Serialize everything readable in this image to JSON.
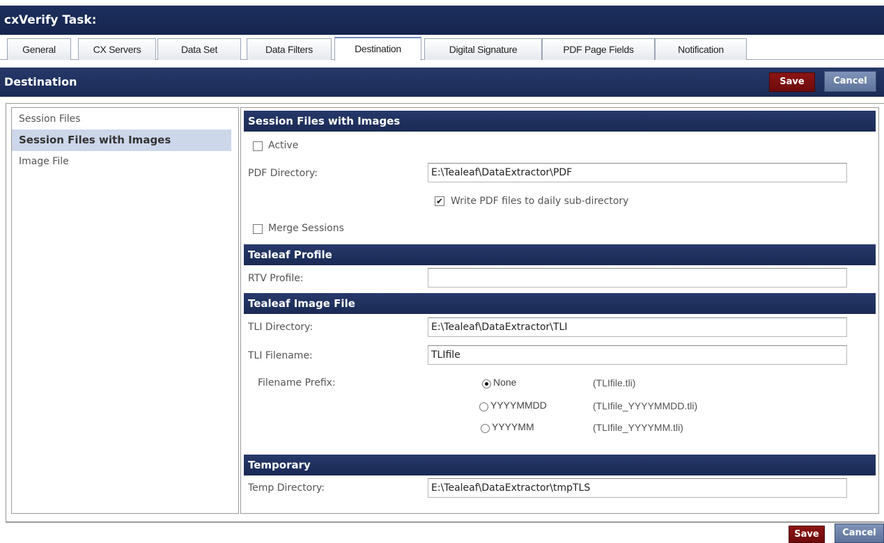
{
  "window": {
    "title": "cxVerify Task:"
  },
  "tabs": [
    {
      "label": "General",
      "active": false
    },
    {
      "label": "CX Servers",
      "active": false
    },
    {
      "label": "Data Set",
      "active": false
    },
    {
      "label": "Data Filters",
      "active": false
    },
    {
      "label": "Destination",
      "active": true
    },
    {
      "label": "Digital Signature",
      "active": false
    },
    {
      "label": "PDF Page Fields",
      "active": false
    },
    {
      "label": "Notification",
      "active": false
    }
  ],
  "section": {
    "title": "Destination",
    "save_label": "Save",
    "cancel_label": "Cancel"
  },
  "sidebar": {
    "items": [
      {
        "label": "Session Files",
        "selected": false
      },
      {
        "label": "Session Files with Images",
        "selected": true
      },
      {
        "label": "Image File",
        "selected": false
      }
    ]
  },
  "session_images": {
    "header": "Session Files with Images",
    "active_label": "Active",
    "active_checked": false,
    "pdf_dir_label": "PDF Directory:",
    "pdf_dir_value": "E:\\Tealeaf\\DataExtractor\\PDF",
    "daily_label": "Write PDF files to daily sub-directory",
    "daily_checked": true,
    "merge_label": "Merge Sessions",
    "merge_checked": false
  },
  "profile": {
    "header": "Tealeaf Profile",
    "rtv_label": "RTV Profile:",
    "rtv_value": ""
  },
  "image_file": {
    "header": "Tealeaf Image File",
    "tli_dir_label": "TLI Directory:",
    "tli_dir_value": "E:\\Tealeaf\\DataExtractor\\TLI",
    "tli_name_label": "TLI Filename:",
    "tli_name_value": "TLIfile",
    "prefix_label": "Filename Prefix:",
    "prefix_options": [
      {
        "label": "None",
        "example": "(TLIfile.tli)",
        "selected": true
      },
      {
        "label": "YYYYMMDD",
        "example": "(TLIfile_YYYYMMDD.tli)",
        "selected": false
      },
      {
        "label": "YYYYMM",
        "example": "(TLIfile_YYYYMM.tli)",
        "selected": false
      }
    ]
  },
  "temporary": {
    "header": "Temporary",
    "temp_label": "Temp Directory:",
    "temp_value": "E:\\Tealeaf\\DataExtractor\\tmpTLS"
  },
  "footer": {
    "save_label": "Save",
    "cancel_label": "Cancel"
  }
}
